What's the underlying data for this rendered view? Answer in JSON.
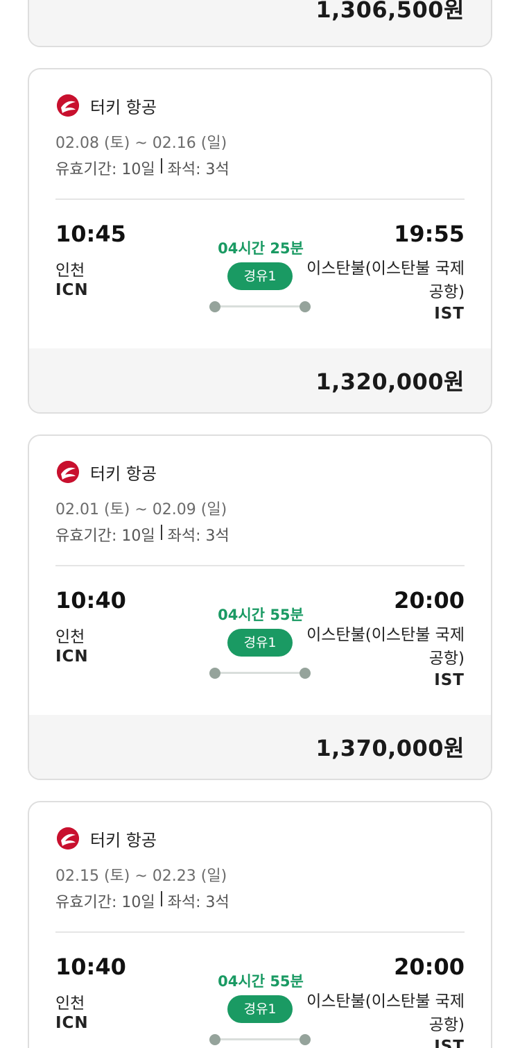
{
  "top_card": {
    "price": "1,306,500원"
  },
  "cards": [
    {
      "airline": "터키 항공",
      "dates": "02.08 (토) ~ 02.16 (일)",
      "validity": "유효기간: 10일",
      "seats": "좌석: 3석",
      "departure": {
        "time": "10:45",
        "city": "인천",
        "code": "ICN"
      },
      "arrival": {
        "time": "19:55",
        "city": "이스탄불(이스탄불 국제공항)",
        "code": "IST"
      },
      "duration": "04시간 25분",
      "stops": "경유1",
      "price": "1,320,000원"
    },
    {
      "airline": "터키 항공",
      "dates": "02.01 (토) ~ 02.09 (일)",
      "validity": "유효기간: 10일",
      "seats": "좌석: 3석",
      "departure": {
        "time": "10:40",
        "city": "인천",
        "code": "ICN"
      },
      "arrival": {
        "time": "20:00",
        "city": "이스탄불(이스탄불 국제공항)",
        "code": "IST"
      },
      "duration": "04시간 55분",
      "stops": "경유1",
      "price": "1,370,000원"
    },
    {
      "airline": "터키 항공",
      "dates": "02.15 (토) ~ 02.23 (일)",
      "validity": "유효기간: 10일",
      "seats": "좌석: 3석",
      "departure": {
        "time": "10:40",
        "city": "인천",
        "code": "ICN"
      },
      "arrival": {
        "time": "20:00",
        "city": "이스탄불(이스탄불 국제공항)",
        "code": "IST"
      },
      "duration": "04시간 55분",
      "stops": "경유1"
    }
  ],
  "colors": {
    "accent_green": "#1a9a63",
    "airline_red": "#c8102e",
    "price_band": "#f5f5f5"
  },
  "icons": {
    "airline_logo": "turkish-airlines-logo-icon"
  }
}
